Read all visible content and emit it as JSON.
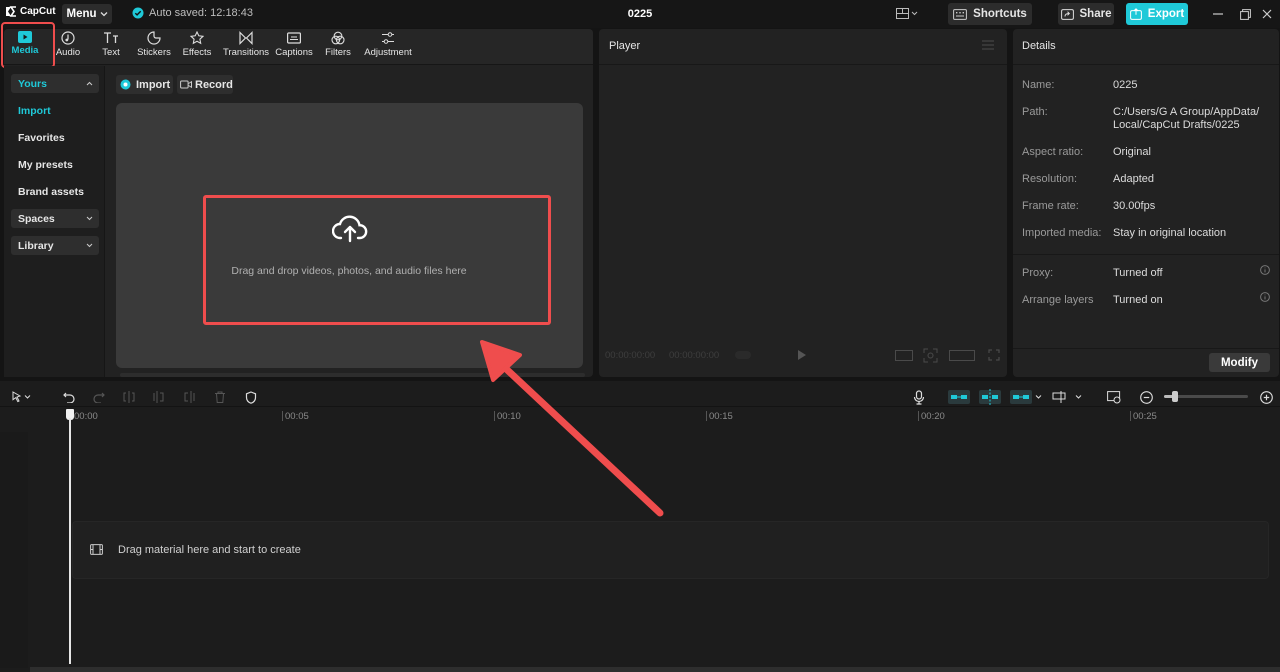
{
  "titlebar": {
    "logo_text": "CapCut",
    "menu_label": "Menu",
    "autosave_text": "Auto saved: 12:18:43",
    "project_title": "0225",
    "shortcuts_label": "Shortcuts",
    "share_label": "Share",
    "export_label": "Export"
  },
  "toolbar": {
    "items": [
      {
        "label": "Media",
        "icon": "media-icon"
      },
      {
        "label": "Audio",
        "icon": "audio-icon"
      },
      {
        "label": "Text",
        "icon": "text-icon"
      },
      {
        "label": "Stickers",
        "icon": "stickers-icon"
      },
      {
        "label": "Effects",
        "icon": "effects-icon"
      },
      {
        "label": "Transitions",
        "icon": "transitions-icon"
      },
      {
        "label": "Captions",
        "icon": "captions-icon"
      },
      {
        "label": "Filters",
        "icon": "filters-icon"
      },
      {
        "label": "Adjustment",
        "icon": "adjustment-icon"
      }
    ]
  },
  "sidebar": {
    "yours": "Yours",
    "import": "Import",
    "favorites": "Favorites",
    "my_presets": "My presets",
    "brand_assets": "Brand assets",
    "spaces": "Spaces",
    "library": "Library"
  },
  "media": {
    "import_label": "Import",
    "record_label": "Record",
    "drop_text": "Drag and drop videos, photos, and audio files here"
  },
  "player": {
    "title": "Player",
    "current_time": "00:00:00:00",
    "total_time": "00:00:00:00"
  },
  "details": {
    "title": "Details",
    "rows": [
      {
        "label": "Name:",
        "value": "0225"
      },
      {
        "label": "Path:",
        "value": "C:/Users/G A Group/AppData/\nLocal/CapCut Drafts/0225"
      },
      {
        "label": "Aspect ratio:",
        "value": "Original"
      },
      {
        "label": "Resolution:",
        "value": "Adapted"
      },
      {
        "label": "Frame rate:",
        "value": "30.00fps"
      },
      {
        "label": "Imported media:",
        "value": "Stay in original location"
      },
      {
        "label": "Proxy:",
        "value": "Turned off"
      },
      {
        "label": "Arrange layers",
        "value": "Turned on"
      }
    ],
    "modify_label": "Modify"
  },
  "timeline": {
    "ruler": [
      "00:00",
      "00:05",
      "00:10",
      "00:15",
      "00:20",
      "00:25"
    ],
    "drop_text": "Drag material here and start to create"
  },
  "colors": {
    "accent": "#1fc9d8",
    "annotation": "#ef4d4d",
    "export_bg": "#1fc9d8"
  }
}
